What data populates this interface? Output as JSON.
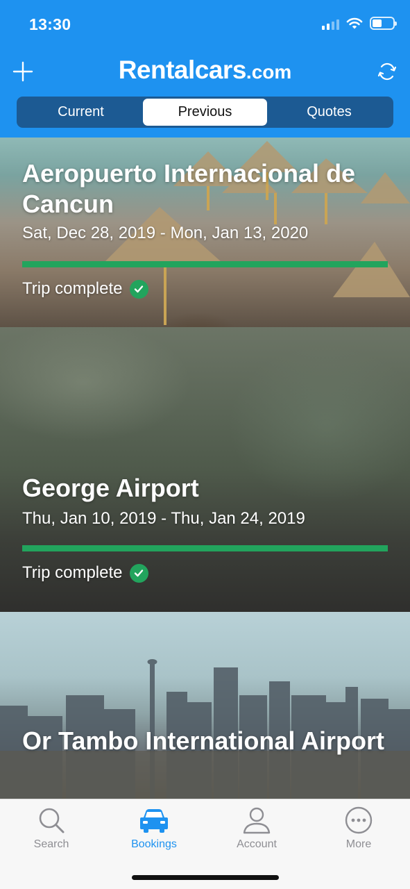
{
  "status_bar": {
    "time": "13:30"
  },
  "header": {
    "brand": "Rentalcars",
    "brand_tld": ".com"
  },
  "segments": [
    {
      "label": "Current",
      "active": false
    },
    {
      "label": "Previous",
      "active": true
    },
    {
      "label": "Quotes",
      "active": false
    }
  ],
  "bookings": [
    {
      "title": "Aeropuerto Internacional de Cancun",
      "dates": "Sat, Dec 28, 2019 - Mon, Jan 13, 2020",
      "progress": 1.0,
      "status": "Trip complete"
    },
    {
      "title": "George Airport",
      "dates": "Thu, Jan 10, 2019 - Thu, Jan 24, 2019",
      "progress": 1.0,
      "status": "Trip complete"
    },
    {
      "title": "Or Tambo International Airport",
      "dates": "",
      "progress": 1.0,
      "status": ""
    }
  ],
  "tabbar": [
    {
      "label": "Search",
      "icon": "search-icon",
      "active": false
    },
    {
      "label": "Bookings",
      "icon": "car-icon",
      "active": true
    },
    {
      "label": "Account",
      "icon": "person-icon",
      "active": false
    },
    {
      "label": "More",
      "icon": "more-icon",
      "active": false
    }
  ],
  "colors": {
    "header_bg": "#1e92f0",
    "segment_bg": "#1c5a93",
    "progress": "#22a45d",
    "tab_active": "#1e92f0",
    "tab_inactive": "#8e8e93"
  }
}
